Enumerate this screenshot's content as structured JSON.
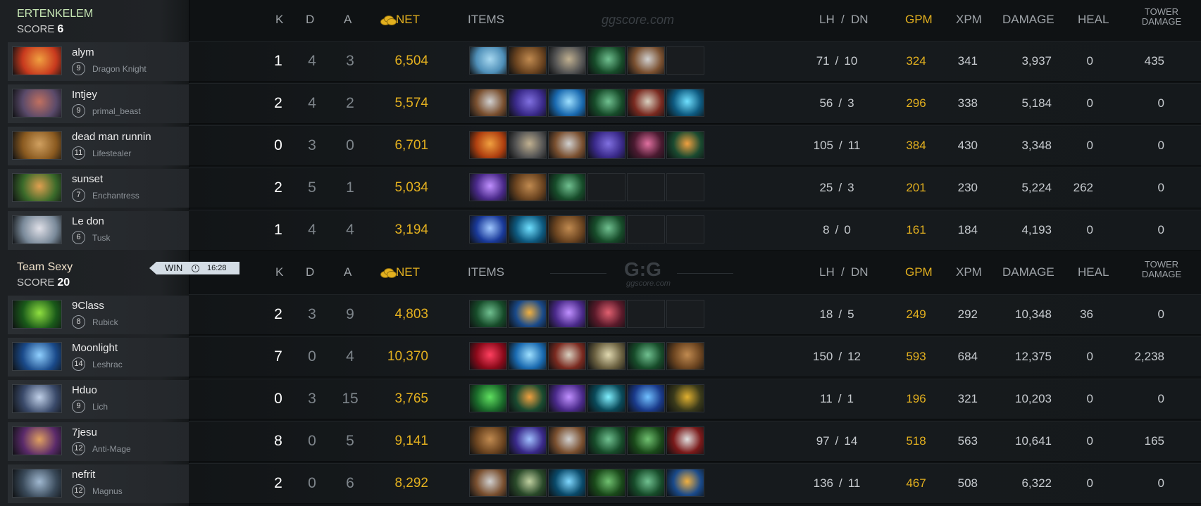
{
  "header": {
    "k": "K",
    "d": "D",
    "a": "A",
    "net": "NET",
    "items": "ITEMS",
    "lh": "LH",
    "slash": "/",
    "dn": "DN",
    "gpm": "GPM",
    "xpm": "XPM",
    "damage": "DAMAGE",
    "heal": "HEAL",
    "tower_line1": "TOWER",
    "tower_line2": "DAMAGE",
    "watermark_top": "ggscore.com",
    "watermark_logo": "G:G",
    "watermark_sub": "ggscore.com"
  },
  "colors": {
    "gold": "#e3b01f",
    "background": "#0f1214",
    "sidebar": "#202326",
    "win_tag": "#d4dde5"
  },
  "result": {
    "label": "WIN",
    "time": "16:28",
    "icon": "clock-icon"
  },
  "teams": [
    {
      "name": "ERTENKELEM",
      "score_label": "SCORE",
      "score": "6",
      "name_color": "#c6e6b4",
      "players": [
        {
          "name": "alym",
          "level": "9",
          "hero": "Dragon Knight",
          "k": "1",
          "d": "4",
          "a": "3",
          "net": "6,504",
          "lh": "71",
          "dn": "10",
          "gpm": "324",
          "xpm": "341",
          "damage": "3,937",
          "heal": "0",
          "tower": "435",
          "portrait": [
            "#c83a1e",
            "#f0a040"
          ],
          "items": [
            {
              "name": "hammer-icon",
              "c": [
                "#4f8fb8",
                "#a7d8f0"
              ]
            },
            {
              "name": "boots-icon",
              "c": [
                "#6b4420",
                "#c08a50"
              ]
            },
            {
              "name": "gauntlet-icon",
              "c": [
                "#555",
                "#c0b090"
              ]
            },
            {
              "name": "branch-icon",
              "c": [
                "#174c2a",
                "#70c090"
              ]
            },
            {
              "name": "axe-icon",
              "c": [
                "#7a5030",
                "#d0d0d0"
              ]
            },
            {
              "name": "empty",
              "c": null
            }
          ]
        },
        {
          "name": "Intjey",
          "level": "9",
          "hero": "primal_beast",
          "k": "2",
          "d": "4",
          "a": "2",
          "net": "5,574",
          "lh": "56",
          "dn": "3",
          "gpm": "296",
          "xpm": "338",
          "damage": "5,184",
          "heal": "0",
          "tower": "0",
          "portrait": [
            "#5a4a6a",
            "#c07060"
          ],
          "items": [
            {
              "name": "axe-icon",
              "c": [
                "#7a5030",
                "#d0d0d0"
              ]
            },
            {
              "name": "cloak-icon",
              "c": [
                "#3a2a8a",
                "#8070e0"
              ]
            },
            {
              "name": "gem-icon",
              "c": [
                "#1a6ab0",
                "#9ee0ff"
              ]
            },
            {
              "name": "branch-icon",
              "c": [
                "#174c2a",
                "#70c090"
              ]
            },
            {
              "name": "battle-axe-icon",
              "c": [
                "#7a2a20",
                "#d8d0c0"
              ]
            },
            {
              "name": "wave-icon",
              "c": [
                "#0e5a80",
                "#70e0ff"
              ]
            }
          ]
        },
        {
          "name": "dead man runnin",
          "level": "11",
          "hero": "Lifestealer",
          "k": "0",
          "d": "3",
          "a": "0",
          "net": "6,701",
          "lh": "105",
          "dn": "11",
          "gpm": "384",
          "xpm": "430",
          "damage": "3,348",
          "heal": "0",
          "tower": "0",
          "portrait": [
            "#8a5a20",
            "#d0a060"
          ],
          "items": [
            {
              "name": "armlet-icon",
              "c": [
                "#b04010",
                "#f0a040"
              ]
            },
            {
              "name": "gauntlet-icon",
              "c": [
                "#555",
                "#c0b090"
              ]
            },
            {
              "name": "axe-icon",
              "c": [
                "#7a5030",
                "#d0d0d0"
              ]
            },
            {
              "name": "cloak-icon",
              "c": [
                "#3a2a8a",
                "#8070e0"
              ]
            },
            {
              "name": "mask-icon",
              "c": [
                "#4a1a30",
                "#e070a0"
              ]
            },
            {
              "name": "blade-icon",
              "c": [
                "#1a4a30",
                "#f0a040"
              ]
            }
          ]
        },
        {
          "name": "sunset",
          "level": "7",
          "hero": "Enchantress",
          "k": "2",
          "d": "5",
          "a": "1",
          "net": "5,034",
          "lh": "25",
          "dn": "3",
          "gpm": "201",
          "xpm": "230",
          "damage": "5,224",
          "heal": "262",
          "tower": "0",
          "portrait": [
            "#3a6a2a",
            "#e0a050"
          ],
          "items": [
            {
              "name": "orb-icon",
              "c": [
                "#4a2a8a",
                "#c090ff"
              ]
            },
            {
              "name": "boots-icon",
              "c": [
                "#6b4420",
                "#c08a50"
              ]
            },
            {
              "name": "branch-icon",
              "c": [
                "#174c2a",
                "#70c090"
              ]
            },
            {
              "name": "empty",
              "c": null
            },
            {
              "name": "empty",
              "c": null
            },
            {
              "name": "empty",
              "c": null
            }
          ]
        },
        {
          "name": "Le don",
          "level": "6",
          "hero": "Tusk",
          "k": "1",
          "d": "4",
          "a": "4",
          "net": "3,194",
          "lh": "8",
          "dn": "0",
          "gpm": "161",
          "xpm": "184",
          "damage": "4,193",
          "heal": "0",
          "tower": "0",
          "portrait": [
            "#7a8a9a",
            "#e0e0e8"
          ],
          "items": [
            {
              "name": "potion-icon",
              "c": [
                "#1a3a9a",
                "#a0c8ff"
              ]
            },
            {
              "name": "wave-icon",
              "c": [
                "#0e5a80",
                "#70e0ff"
              ]
            },
            {
              "name": "boots-icon",
              "c": [
                "#6b4420",
                "#c08a50"
              ]
            },
            {
              "name": "branch-icon",
              "c": [
                "#174c2a",
                "#70c090"
              ]
            },
            {
              "name": "empty",
              "c": null
            },
            {
              "name": "empty",
              "c": null
            }
          ]
        }
      ]
    },
    {
      "name": "Team Sexy",
      "score_label": "SCORE",
      "score": "20",
      "name_color": "#f2e3cc",
      "players": [
        {
          "name": "9Class",
          "level": "8",
          "hero": "Rubick",
          "k": "2",
          "d": "3",
          "a": "9",
          "net": "4,803",
          "lh": "18",
          "dn": "5",
          "gpm": "249",
          "xpm": "292",
          "damage": "10,348",
          "heal": "36",
          "tower": "0",
          "portrait": [
            "#1a5a1a",
            "#90e040"
          ],
          "items": [
            {
              "name": "branch-icon",
              "c": [
                "#174c2a",
                "#70c090"
              ]
            },
            {
              "name": "bottle-icon",
              "c": [
                "#1a4a8a",
                "#f0b040"
              ]
            },
            {
              "name": "orb-icon",
              "c": [
                "#4a2a8a",
                "#c090ff"
              ]
            },
            {
              "name": "helm-icon",
              "c": [
                "#5a1a2a",
                "#e06070"
              ]
            },
            {
              "name": "empty",
              "c": null
            },
            {
              "name": "empty",
              "c": null
            }
          ]
        },
        {
          "name": "Moonlight",
          "level": "14",
          "hero": "Leshrac",
          "k": "7",
          "d": "0",
          "a": "4",
          "net": "10,370",
          "lh": "150",
          "dn": "12",
          "gpm": "593",
          "xpm": "684",
          "damage": "12,375",
          "heal": "0",
          "tower": "2,238",
          "portrait": [
            "#1a4a8a",
            "#90d0ff"
          ],
          "items": [
            {
              "name": "crystal-icon",
              "c": [
                "#8a0a1a",
                "#ff4060"
              ]
            },
            {
              "name": "gem-icon",
              "c": [
                "#1a6ab0",
                "#9ee0ff"
              ]
            },
            {
              "name": "battle-axe-icon",
              "c": [
                "#7a2a20",
                "#d8d0c0"
              ]
            },
            {
              "name": "mushroom-icon",
              "c": [
                "#6a6040",
                "#e0d8b0"
              ]
            },
            {
              "name": "branch-icon",
              "c": [
                "#174c2a",
                "#70c090"
              ]
            },
            {
              "name": "boots-icon",
              "c": [
                "#6b4420",
                "#c08a50"
              ]
            }
          ]
        },
        {
          "name": "Hduo",
          "level": "9",
          "hero": "Lich",
          "k": "0",
          "d": "3",
          "a": "15",
          "net": "3,765",
          "lh": "11",
          "dn": "1",
          "gpm": "196",
          "xpm": "321",
          "damage": "10,203",
          "heal": "0",
          "tower": "0",
          "portrait": [
            "#3a4a6a",
            "#c0d0e8"
          ],
          "items": [
            {
              "name": "tranquil-boots-icon",
              "c": [
                "#1a6a2a",
                "#60e060"
              ]
            },
            {
              "name": "blade-icon",
              "c": [
                "#1a4a30",
                "#f0a040"
              ]
            },
            {
              "name": "orb-icon",
              "c": [
                "#4a2a8a",
                "#c090ff"
              ]
            },
            {
              "name": "drop-icon",
              "c": [
                "#0a4a5a",
                "#80f0ff"
              ]
            },
            {
              "name": "skull-icon",
              "c": [
                "#1a3a8a",
                "#70c0ff"
              ]
            },
            {
              "name": "claw-icon",
              "c": [
                "#3a3a1a",
                "#e0b030"
              ]
            }
          ]
        },
        {
          "name": "7jesu",
          "level": "12",
          "hero": "Anti-Mage",
          "k": "8",
          "d": "0",
          "a": "5",
          "net": "9,141",
          "lh": "97",
          "dn": "14",
          "gpm": "518",
          "xpm": "563",
          "damage": "10,641",
          "heal": "0",
          "tower": "165",
          "portrait": [
            "#5a2a6a",
            "#e0a060"
          ],
          "items": [
            {
              "name": "boots-icon",
              "c": [
                "#6b4420",
                "#c08a50"
              ]
            },
            {
              "name": "scimitar-icon",
              "c": [
                "#3a2a8a",
                "#a0c0ff"
              ]
            },
            {
              "name": "axe-icon",
              "c": [
                "#7a5030",
                "#d0d0d0"
              ]
            },
            {
              "name": "branch-icon",
              "c": [
                "#174c2a",
                "#70c090"
              ]
            },
            {
              "name": "wraith-icon",
              "c": [
                "#1a4a1a",
                "#70c070"
              ]
            },
            {
              "name": "shield-icon",
              "c": [
                "#7a1a1a",
                "#e0e0e0"
              ]
            }
          ]
        },
        {
          "name": "nefrit",
          "level": "12",
          "hero": "Magnus",
          "k": "2",
          "d": "0",
          "a": "6",
          "net": "8,292",
          "lh": "136",
          "dn": "11",
          "gpm": "467",
          "xpm": "508",
          "damage": "6,322",
          "heal": "0",
          "tower": "0",
          "portrait": [
            "#3a4a5a",
            "#a0b8d0"
          ],
          "items": [
            {
              "name": "axe-icon",
              "c": [
                "#7a5030",
                "#d0d0d0"
              ]
            },
            {
              "name": "spear-icon",
              "c": [
                "#2a4a2a",
                "#c0d0a0"
              ]
            },
            {
              "name": "blade-mail-icon",
              "c": [
                "#0a4a6a",
                "#80d8ff"
              ]
            },
            {
              "name": "wraith-icon",
              "c": [
                "#1a4a1a",
                "#70c070"
              ]
            },
            {
              "name": "branch-icon",
              "c": [
                "#174c2a",
                "#70c090"
              ]
            },
            {
              "name": "bottle-icon",
              "c": [
                "#1a4a8a",
                "#f0b040"
              ]
            }
          ]
        }
      ]
    }
  ]
}
